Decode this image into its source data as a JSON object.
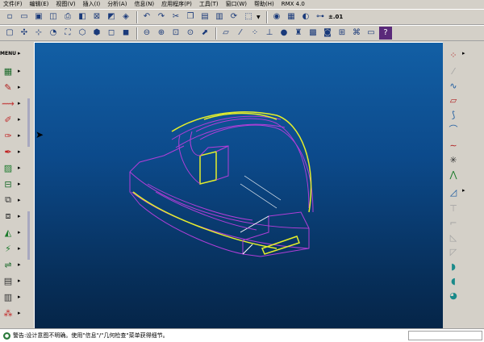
{
  "menubar": {
    "items": [
      "文件(F)",
      "编辑(E)",
      "视图(V)",
      "插入(I)",
      "分析(A)",
      "信息(N)",
      "应用程序(P)",
      "工具(T)",
      "窗口(W)",
      "帮助(H)",
      "RMX 4.0"
    ]
  },
  "toolbar1": {
    "icons": [
      "new-icon",
      "open-icon",
      "save-icon",
      "save-copy-icon",
      "print-icon",
      "print-preview-icon",
      "close-window-icon",
      "erase-icon",
      "info-icon",
      "undo-icon",
      "redo-icon",
      "cut-icon",
      "copy-icon",
      "paste-icon",
      "paste-special-icon",
      "regenerate-icon",
      "select-box-icon"
    ],
    "right_label": "±.01"
  },
  "toolbar2": {
    "icons": [
      "repaint-icon",
      "spin-center-icon",
      "datum-display-icon",
      "orient-mode-icon",
      "view-manager-icon",
      "wireframe-icon",
      "hidden-line-icon",
      "no-hidden-icon",
      "shading-icon",
      "zoom-out-icon",
      "zoom-in-icon",
      "zoom-fit-icon",
      "refit-icon",
      "view-orient-icon",
      "datum-planes-icon",
      "datum-axes-icon",
      "datum-points-icon",
      "coord-sys-icon",
      "appearance-icon",
      "model-tree-icon",
      "layer-icon",
      "cam-icon",
      "measure-icon",
      "mapkey-icon",
      "window-icon",
      "context-help-icon"
    ]
  },
  "left_tools": {
    "menu_label": "MENU",
    "items": [
      "mold-icon",
      "die-icon",
      "sheetmetal-icon",
      "weld-icon",
      "pipe-icon",
      "cable-icon",
      "mechanism-icon",
      "fixture-icon",
      "surface-icon",
      "harness-icon",
      "render-icon",
      "plastic-icon",
      "analysis-icon",
      "nc-icon",
      "tool-icon",
      "report-icon",
      "assembly-icon"
    ]
  },
  "right_tools": {
    "items": [
      "datum-plane-icon",
      "datum-axis-icon",
      "datum-curve-icon",
      "datum-point-icon",
      "coordinate-icon",
      "sketch-icon",
      "curve-icon",
      "star-icon",
      "sweep-icon",
      "edit-icon",
      "point-pattern-icon",
      "round-icon",
      "chamfer-icon",
      "draft-icon",
      "shell-icon",
      "rib-icon",
      "hole-icon"
    ]
  },
  "status": {
    "icon": "warning-icon",
    "text": "警告:设计意图不明确。使用\"信息\"/\"几何检查\"菜单获得细节。"
  },
  "colors": {
    "viewport_top": "#125fa5",
    "viewport_bottom": "#052548",
    "model_edge": "#b23ed8",
    "highlight_edge": "#e5ef2a",
    "hidden_edge": "#ffffff"
  }
}
